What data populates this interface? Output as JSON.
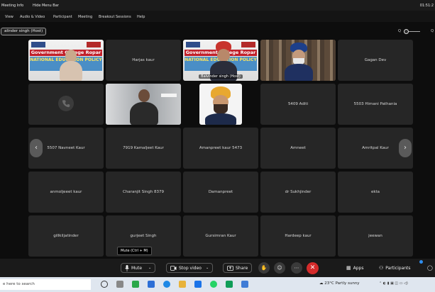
{
  "titlebar": {
    "meeting_info": "Meeting Info",
    "hide_menu_bar": "Hide Menu Bar",
    "clock": "01:51:2"
  },
  "menubar": {
    "items": [
      "View",
      "Audio & Video",
      "Participant",
      "Meeting",
      "Breakout Sessions",
      "Help"
    ]
  },
  "host_label": "alinder singh (Host)",
  "zoom": {
    "icon_left": "Q",
    "icon_right": "Q"
  },
  "tiles": {
    "r1c1_banner_top": "Government College Ropar",
    "r1c1_banner_bottom": "NATIONAL EDUCATION POLICY",
    "r1c2": "Harjas kaur",
    "r1c3_banner_top": "Government College Ropar",
    "r1c3_banner_bottom": "NATIONAL EDUCATION POLICY",
    "r1c3_caption": "Balvinder singh (Host)",
    "r1c5": "Gagan Dev",
    "r2c4": "5409 Aditi",
    "r2c5": "5503 Himani Pathania",
    "r3c1": "5507 Navneet Kaur",
    "r3c2": "7919 Kamaljeet Kaur",
    "r3c3": "Amanpreet kaur 5473",
    "r3c4": "Amneet",
    "r3c5": "Amritpal Kaur",
    "r4c1": "anmoljeeet kaur",
    "r4c2": "Charanjit Singh 8379",
    "r4c3": "Damanpreet",
    "r4c4": "dr Sukhjinder",
    "r4c5": "ekta",
    "r5c1": "gillkiljatinder",
    "r5c2": "gurjeet Singh",
    "r5c3": "Gursimran Kaur",
    "r5c4": "Hardeep kaur",
    "r5c5": "jeewan"
  },
  "tooltip": "Mute (Ctrl + M)",
  "toolbar": {
    "mute": "Mute",
    "stop_video": "Stop video",
    "share": "Share",
    "apps": "Apps",
    "participants": "Participants"
  },
  "taskbar": {
    "search": "e here to search",
    "weather": "23°C  Partly sunny"
  },
  "colors": {
    "end_button": "#d42b2b",
    "tile_bg": "#262626",
    "app_bg": "#0d0d0d",
    "taskbar_bg": "#dfe6ef"
  }
}
